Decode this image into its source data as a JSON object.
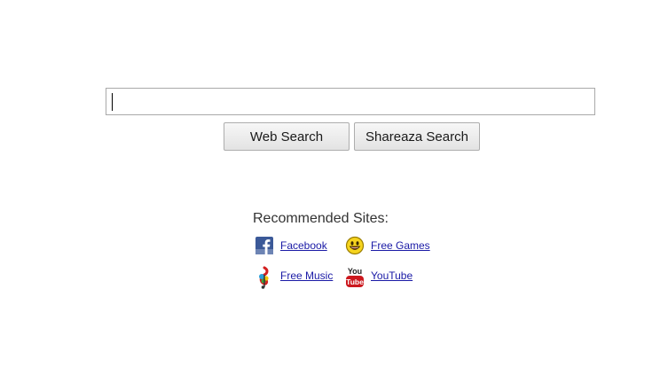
{
  "search": {
    "value": "",
    "placeholder": ""
  },
  "buttons": {
    "web_search": "Web Search",
    "shareaza_search": "Shareaza Search"
  },
  "recommended": {
    "title": "Recommended Sites:",
    "sites": [
      {
        "label": "Facebook",
        "icon": "facebook-icon"
      },
      {
        "label": "Free Games",
        "icon": "smiley-icon"
      },
      {
        "label": "Free Music",
        "icon": "music-note-icon"
      },
      {
        "label": "YouTube",
        "icon": "youtube-icon"
      }
    ]
  },
  "colors": {
    "link": "#1a1aa6",
    "facebook": "#3b5998",
    "youtube": "#cc181e"
  }
}
